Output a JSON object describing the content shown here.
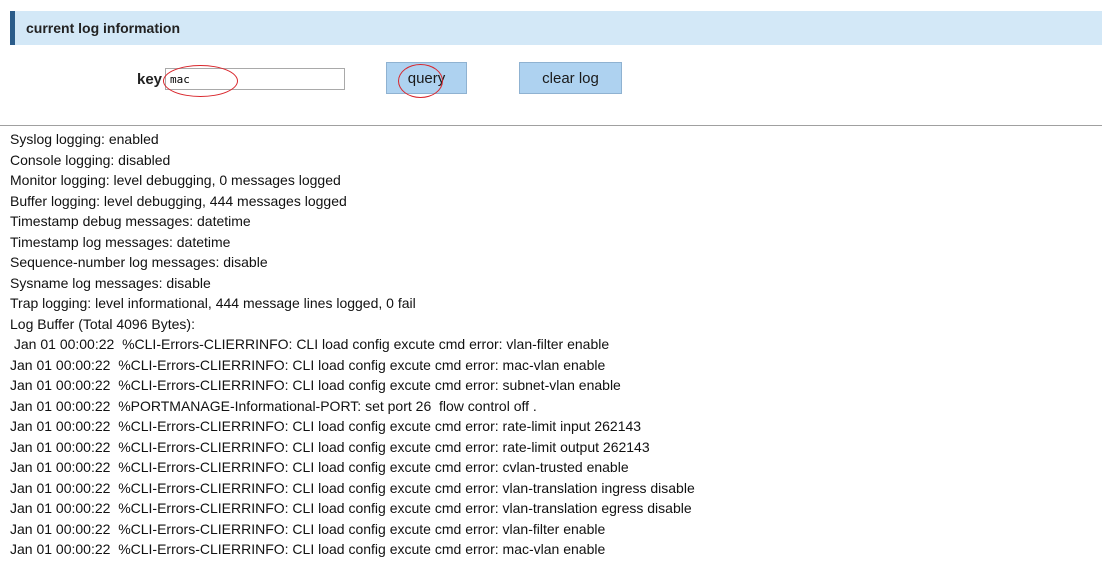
{
  "header": {
    "title": "current log information"
  },
  "search": {
    "key_label": "key",
    "value": "mac",
    "query_label": "query",
    "clear_label": "clear log"
  },
  "log": {
    "lines": [
      "Syslog logging: enabled",
      "Console logging: disabled",
      "Monitor logging: level debugging, 0 messages logged",
      "Buffer logging: level debugging, 444 messages logged",
      "Timestamp debug messages: datetime",
      "Timestamp log messages: datetime",
      "Sequence-number log messages: disable",
      "Sysname log messages: disable",
      "Trap logging: level informational, 444 message lines logged, 0 fail",
      "Log Buffer (Total 4096 Bytes):",
      " Jan 01 00:00:22  %CLI-Errors-CLIERRINFO: CLI load config excute cmd error: vlan-filter enable",
      "Jan 01 00:00:22  %CLI-Errors-CLIERRINFO: CLI load config excute cmd error: mac-vlan enable",
      "Jan 01 00:00:22  %CLI-Errors-CLIERRINFO: CLI load config excute cmd error: subnet-vlan enable",
      "Jan 01 00:00:22  %PORTMANAGE-Informational-PORT: set port 26  flow control off .",
      "Jan 01 00:00:22  %CLI-Errors-CLIERRINFO: CLI load config excute cmd error: rate-limit input 262143",
      "Jan 01 00:00:22  %CLI-Errors-CLIERRINFO: CLI load config excute cmd error: rate-limit output 262143",
      "Jan 01 00:00:22  %CLI-Errors-CLIERRINFO: CLI load config excute cmd error: cvlan-trusted enable",
      "Jan 01 00:00:22  %CLI-Errors-CLIERRINFO: CLI load config excute cmd error: vlan-translation ingress disable",
      "Jan 01 00:00:22  %CLI-Errors-CLIERRINFO: CLI load config excute cmd error: vlan-translation egress disable",
      "Jan 01 00:00:22  %CLI-Errors-CLIERRINFO: CLI load config excute cmd error: vlan-filter enable",
      "Jan 01 00:00:22  %CLI-Errors-CLIERRINFO: CLI load config excute cmd error: mac-vlan enable"
    ]
  },
  "colors": {
    "header_bg": "#d3e8f7",
    "header_accent": "#2b5c8a",
    "button_bg": "#aed2f0",
    "annotation": "#d9262c"
  }
}
